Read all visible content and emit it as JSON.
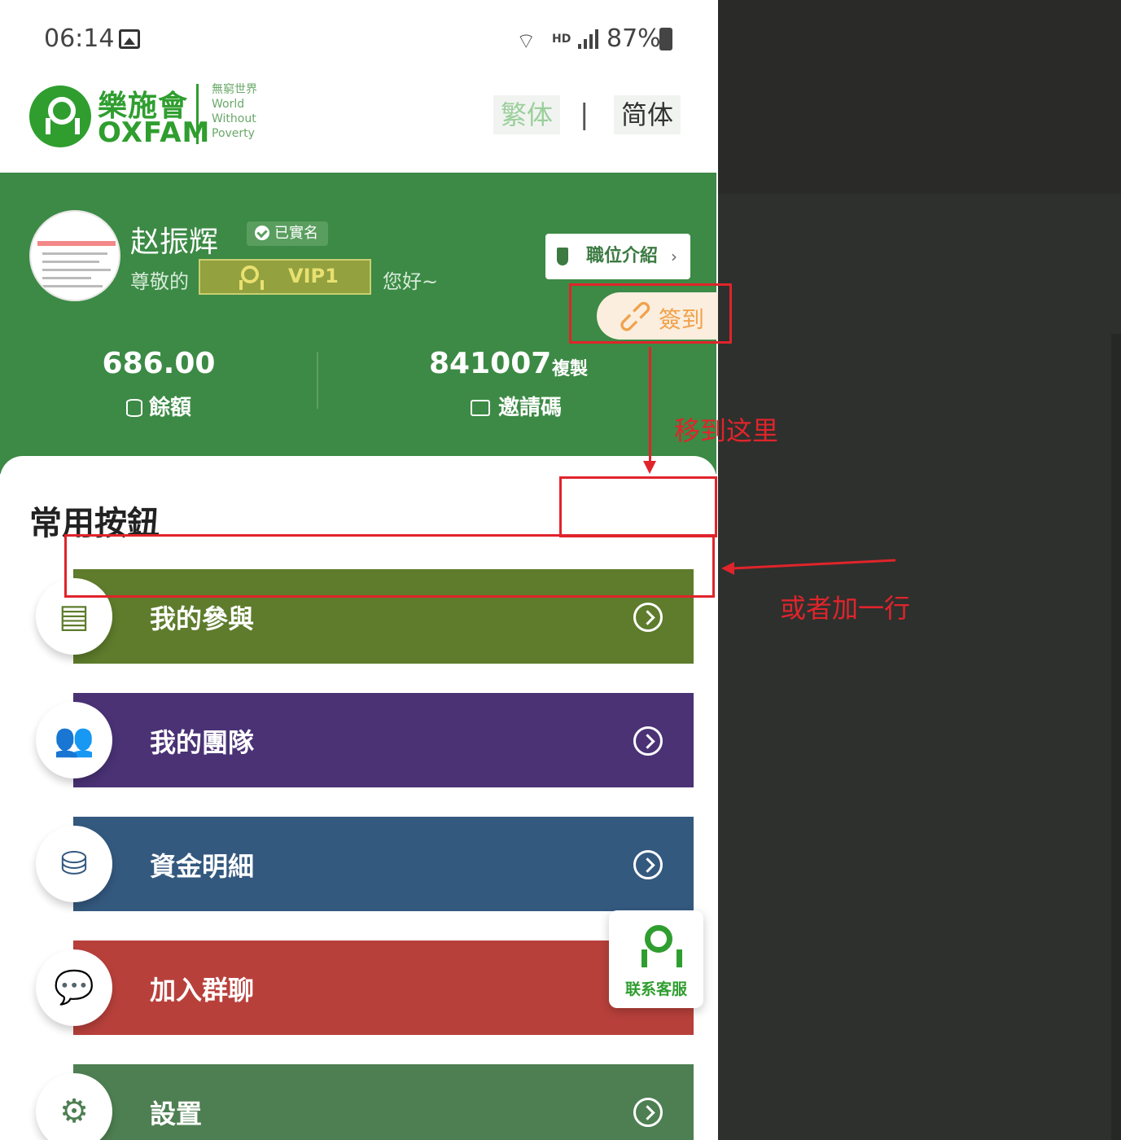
{
  "status_bar": {
    "time": "06:14",
    "hd": "HD",
    "battery": "87%",
    "icons": [
      "gallery-icon",
      "wifi-icon",
      "signal-icon",
      "battery-icon"
    ]
  },
  "header": {
    "logo_cn": "樂施會",
    "logo_en": "OXFAM",
    "logo_tagline": [
      "無窮世界",
      "World",
      "Without",
      "Poverty"
    ],
    "lang_traditional": "繁体",
    "lang_separator": "|",
    "lang_simplified": "简体"
  },
  "profile": {
    "name": "赵振辉",
    "verified": "已實名",
    "respect_prefix": "尊敬的",
    "vip_level": "VIP1",
    "greeting": "您好~",
    "position_button": "職位介紹",
    "position_chevron": "›",
    "checkin_button": "簽到",
    "balance_value": "686.00",
    "balance_label": "餘額",
    "invite_code": "841007",
    "copy_label": "複製",
    "invite_label": "邀請碼"
  },
  "main": {
    "section_title": "常用按鈕",
    "menu": [
      {
        "label": "我的參與",
        "color": "#5e7c2c",
        "icon": "participation-icon"
      },
      {
        "label": "我的團隊",
        "color": "#4a3275",
        "icon": "team-icon"
      },
      {
        "label": "資金明細",
        "color": "#34597f",
        "icon": "funds-detail-icon"
      },
      {
        "label": "加入群聊",
        "color": "#b8403b",
        "icon": "group-chat-icon"
      },
      {
        "label": "設置",
        "color": "#4e7f52",
        "icon": "gear-icon"
      }
    ]
  },
  "service_button": {
    "label": "联系客服"
  },
  "annotations": {
    "move_here": "移到这里",
    "or_add_row": "或者加一行",
    "color": "#e0242b"
  },
  "colors": {
    "brand_green": "#2f9e2f",
    "profile_green": "#3c8a45",
    "checkin_orange": "#f0a24c"
  }
}
